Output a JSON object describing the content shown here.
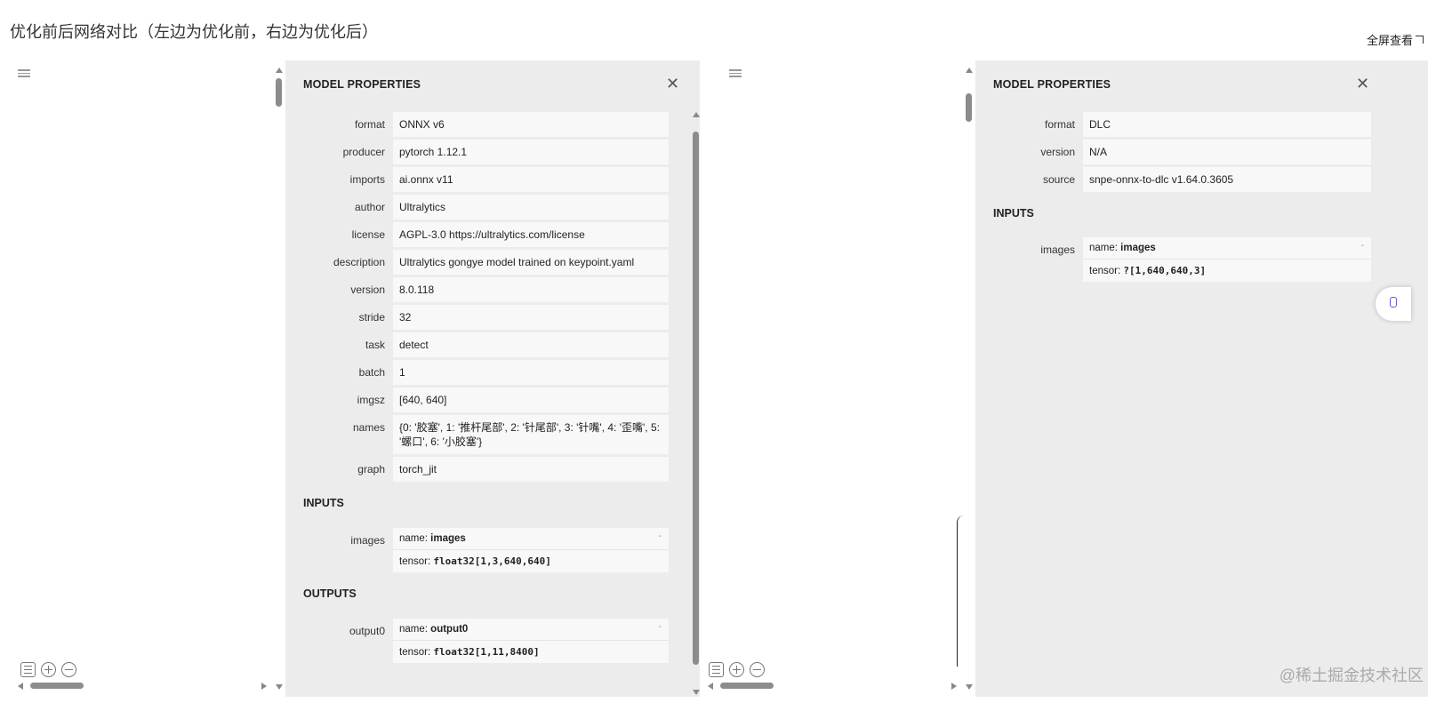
{
  "page": {
    "title": "优化前后网络对比（左边为优化前，右边为优化后）",
    "fullscreen_label": "全屏查看"
  },
  "left": {
    "header": "MODEL PROPERTIES",
    "properties": [
      {
        "label": "format",
        "value": "ONNX v6"
      },
      {
        "label": "producer",
        "value": "pytorch 1.12.1"
      },
      {
        "label": "imports",
        "value": "ai.onnx v11"
      },
      {
        "label": "author",
        "value": "Ultralytics"
      },
      {
        "label": "license",
        "value": "AGPL-3.0 https://ultralytics.com/license"
      },
      {
        "label": "description",
        "value": "Ultralytics gongye model trained on keypoint.yaml"
      },
      {
        "label": "version",
        "value": "8.0.118"
      },
      {
        "label": "stride",
        "value": "32"
      },
      {
        "label": "task",
        "value": "detect"
      },
      {
        "label": "batch",
        "value": "1"
      },
      {
        "label": "imgsz",
        "value": "[640, 640]"
      },
      {
        "label": "names",
        "value": "{0: '胶塞', 1: '推杆尾部', 2: '针尾部', 3: '针嘴', 4: '歪嘴', 5: '螺口', 6: '小胶塞'}"
      },
      {
        "label": "graph",
        "value": "torch_jit"
      }
    ],
    "inputs_title": "INPUTS",
    "input": {
      "label": "images",
      "name_prefix": "name: ",
      "name": "images",
      "tensor_prefix": "tensor: ",
      "tensor": "float32[1,3,640,640]",
      "toggle": "-"
    },
    "outputs_title": "OUTPUTS",
    "output": {
      "label": "output0",
      "name_prefix": "name: ",
      "name": "output0",
      "tensor_prefix": "tensor: ",
      "tensor": "float32[1,11,8400]",
      "toggle": "-"
    }
  },
  "right": {
    "header": "MODEL PROPERTIES",
    "properties": [
      {
        "label": "format",
        "value": "DLC"
      },
      {
        "label": "version",
        "value": "N/A"
      },
      {
        "label": "source",
        "value": "snpe-onnx-to-dlc v1.64.0.3605"
      }
    ],
    "inputs_title": "INPUTS",
    "input": {
      "label": "images",
      "name_prefix": "name: ",
      "name": "images",
      "tensor_prefix": "tensor: ",
      "tensor": "?[1,640,640,3]",
      "toggle": "-"
    }
  },
  "icons": {
    "close": "✕",
    "menu": "menu-icon",
    "list": "list-icon",
    "zoom_in": "zoom-in-icon",
    "zoom_out": "zoom-out-icon"
  },
  "watermark": "@稀土掘金技术社区"
}
